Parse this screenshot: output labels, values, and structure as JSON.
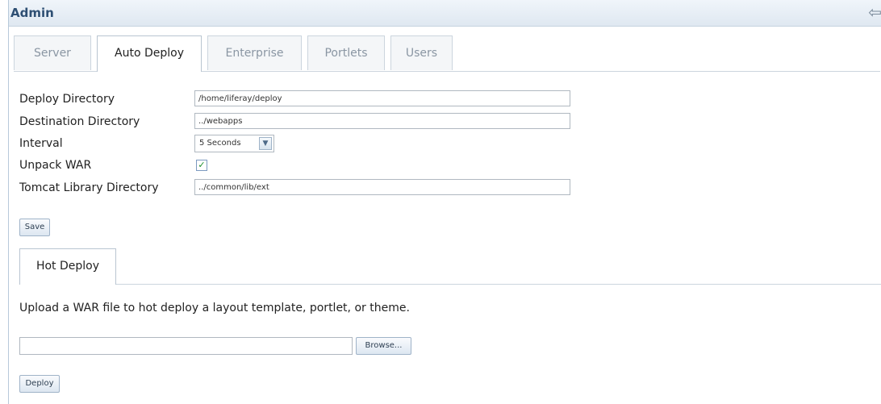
{
  "portlet": {
    "title": "Admin",
    "back_icon": "back-arrow-icon"
  },
  "tabs": [
    {
      "label": "Server",
      "active": false
    },
    {
      "label": "Auto Deploy",
      "active": true
    },
    {
      "label": "Enterprise",
      "active": false
    },
    {
      "label": "Portlets",
      "active": false
    },
    {
      "label": "Users",
      "active": false
    }
  ],
  "form": {
    "deploy_directory": {
      "label": "Deploy Directory",
      "value": "/home/liferay/deploy"
    },
    "destination_directory": {
      "label": "Destination Directory",
      "value": "../webapps"
    },
    "interval": {
      "label": "Interval",
      "value": "5 Seconds"
    },
    "unpack_war": {
      "label": "Unpack WAR",
      "checked": true
    },
    "tomcat_library_directory": {
      "label": "Tomcat Library Directory",
      "value": "../common/lib/ext"
    },
    "save_label": "Save"
  },
  "hot_deploy": {
    "tab_label": "Hot Deploy",
    "description": "Upload a WAR file to hot deploy a layout template, portlet, or theme.",
    "file_value": "",
    "browse_label": "Browse...",
    "deploy_label": "Deploy"
  },
  "colors": {
    "title": "#2e4f73",
    "titlebar_bg": "#dfe8f1",
    "check": "#1e8f2c"
  }
}
